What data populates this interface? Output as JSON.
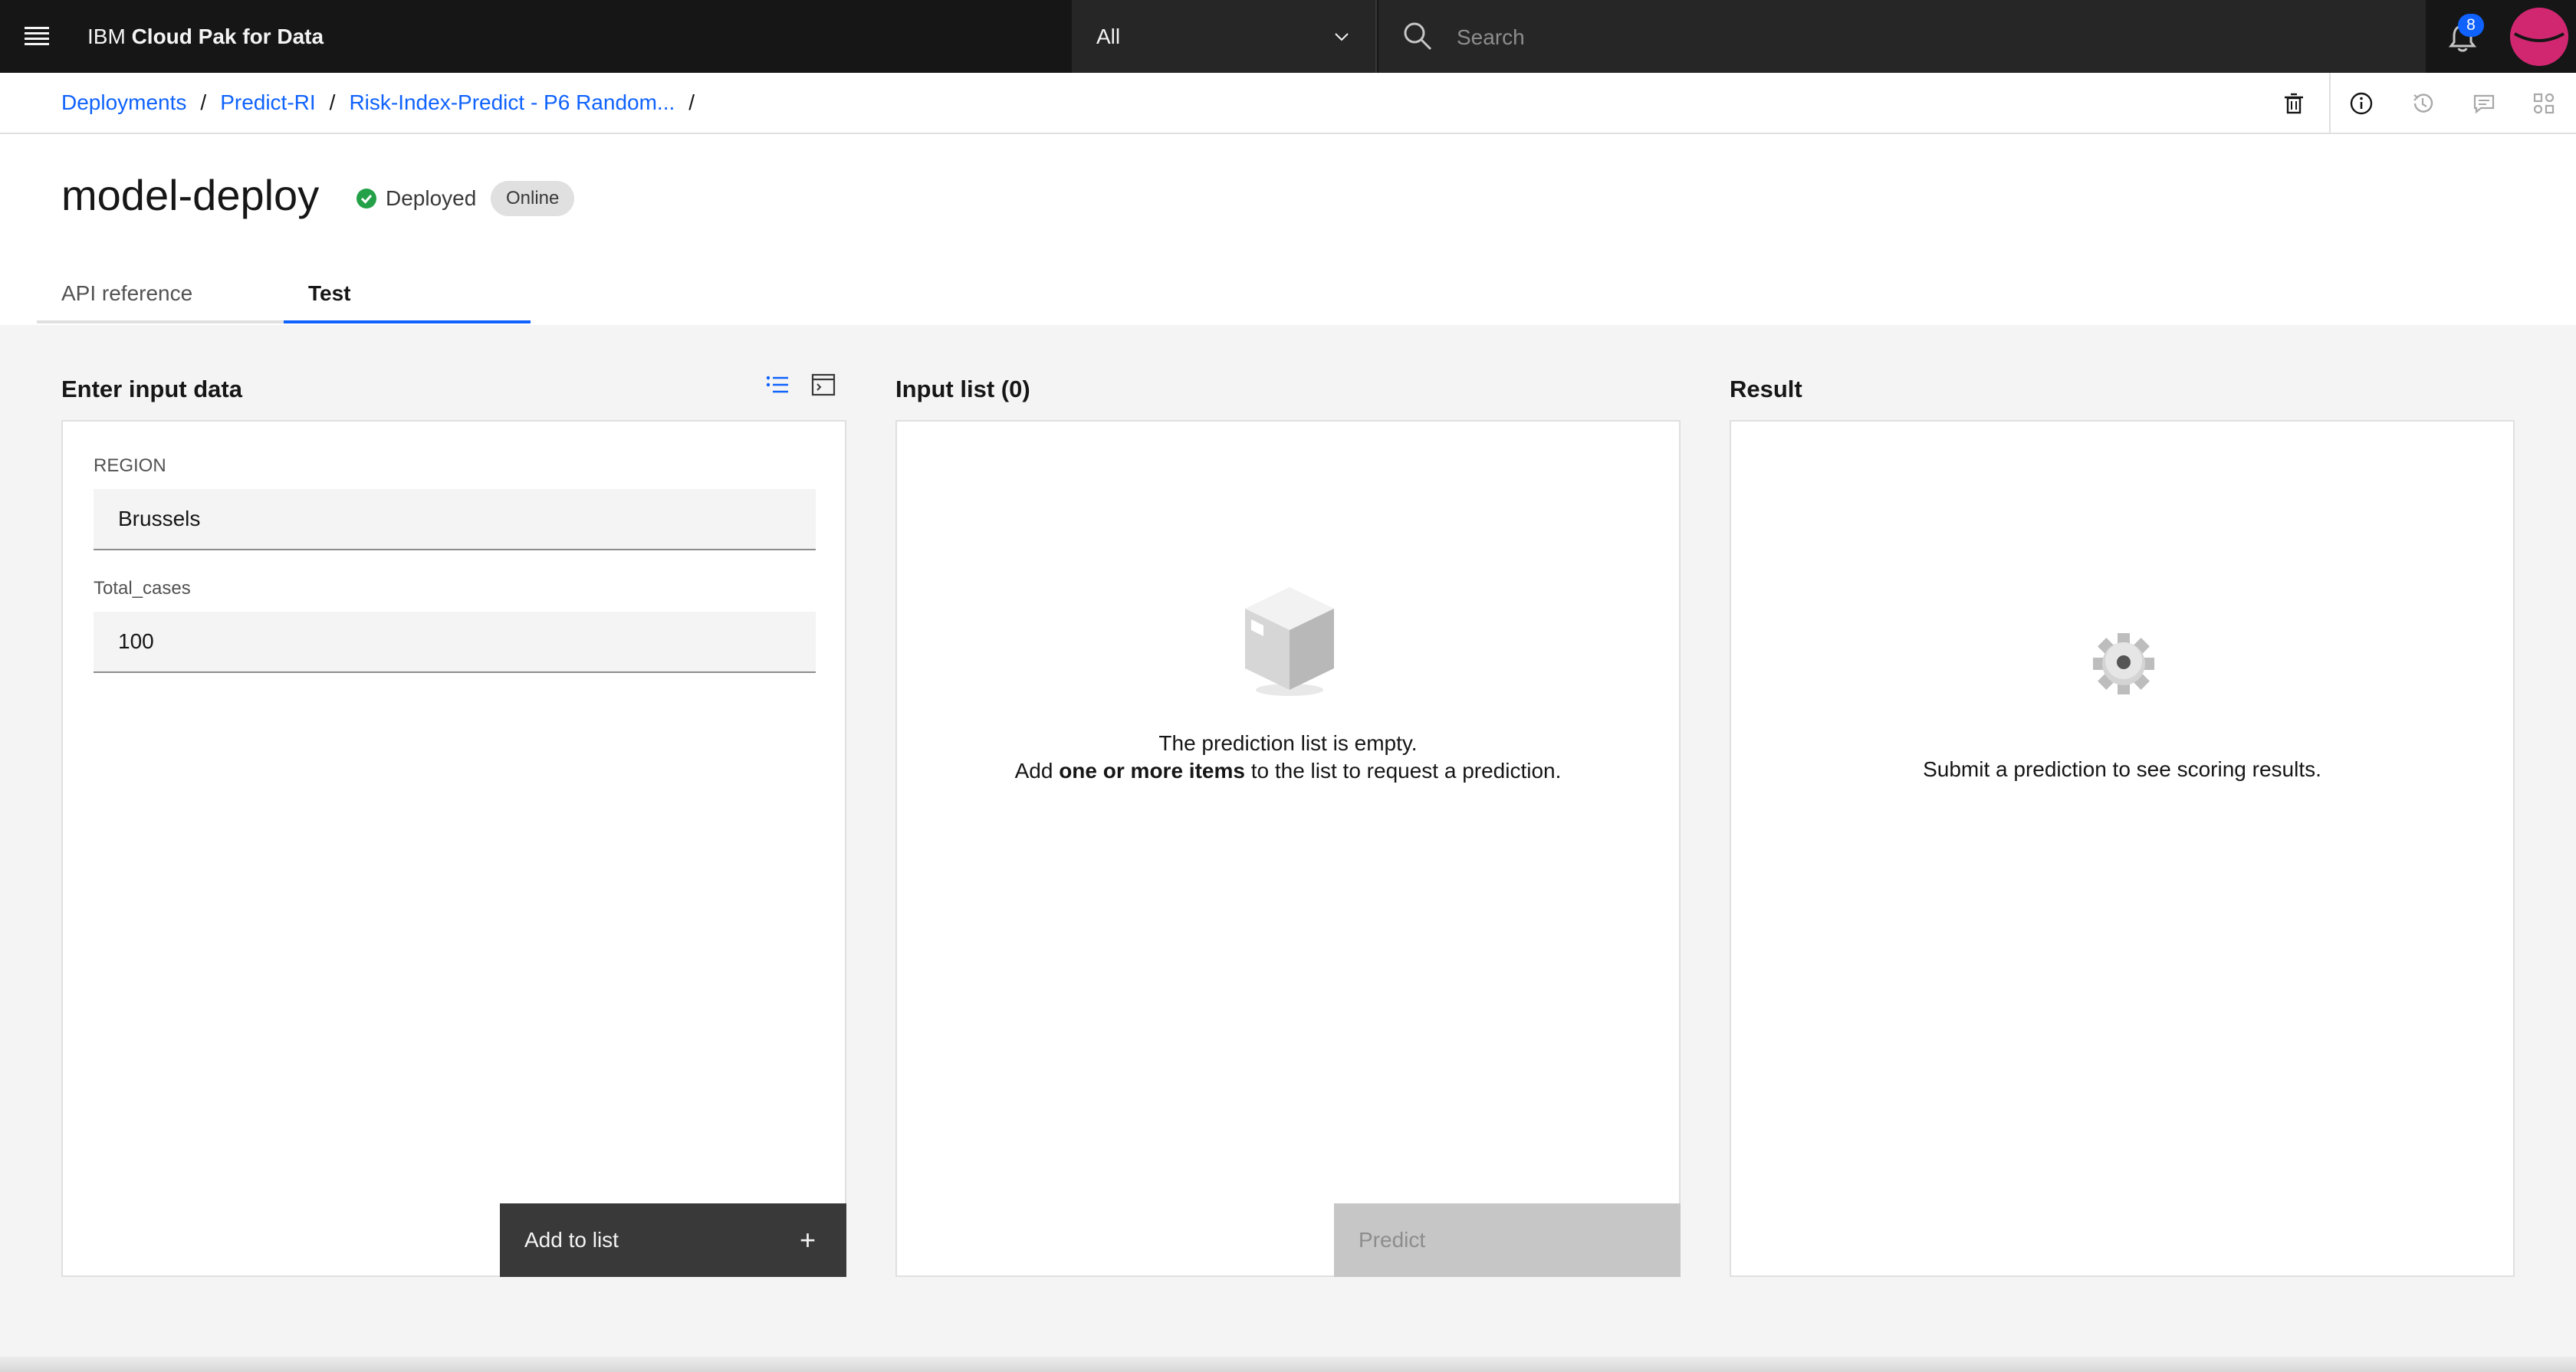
{
  "header": {
    "brand_prefix": "IBM",
    "brand_name": "Cloud Pak for Data",
    "scope_value": "All",
    "search_placeholder": "Search",
    "notification_count": "8"
  },
  "breadcrumb": {
    "items": [
      "Deployments",
      "Predict-RI",
      "Risk-Index-Predict - P6 Random..."
    ],
    "separator": "/"
  },
  "page": {
    "title": "model-deploy",
    "status": "Deployed",
    "tag": "Online"
  },
  "tabs": [
    {
      "label": "API reference",
      "active": false
    },
    {
      "label": "Test",
      "active": true
    }
  ],
  "input_panel": {
    "title": "Enter input data",
    "fields": [
      {
        "label": "REGION",
        "value": "Brussels"
      },
      {
        "label": "Total_cases",
        "value": "100"
      }
    ],
    "add_button": "Add to list"
  },
  "list_panel": {
    "title": "Input list (0)",
    "empty_line1": "The prediction list is empty.",
    "empty_line2_pre": "Add ",
    "empty_line2_bold": "one or more items",
    "empty_line2_post": " to the list to request a prediction.",
    "predict_button": "Predict"
  },
  "result_panel": {
    "title": "Result",
    "empty_text": "Submit a prediction to see scoring results."
  },
  "colors": {
    "accent": "#0f62fe",
    "header_bg": "#161616",
    "success": "#24a148",
    "avatar": "#d12771"
  }
}
